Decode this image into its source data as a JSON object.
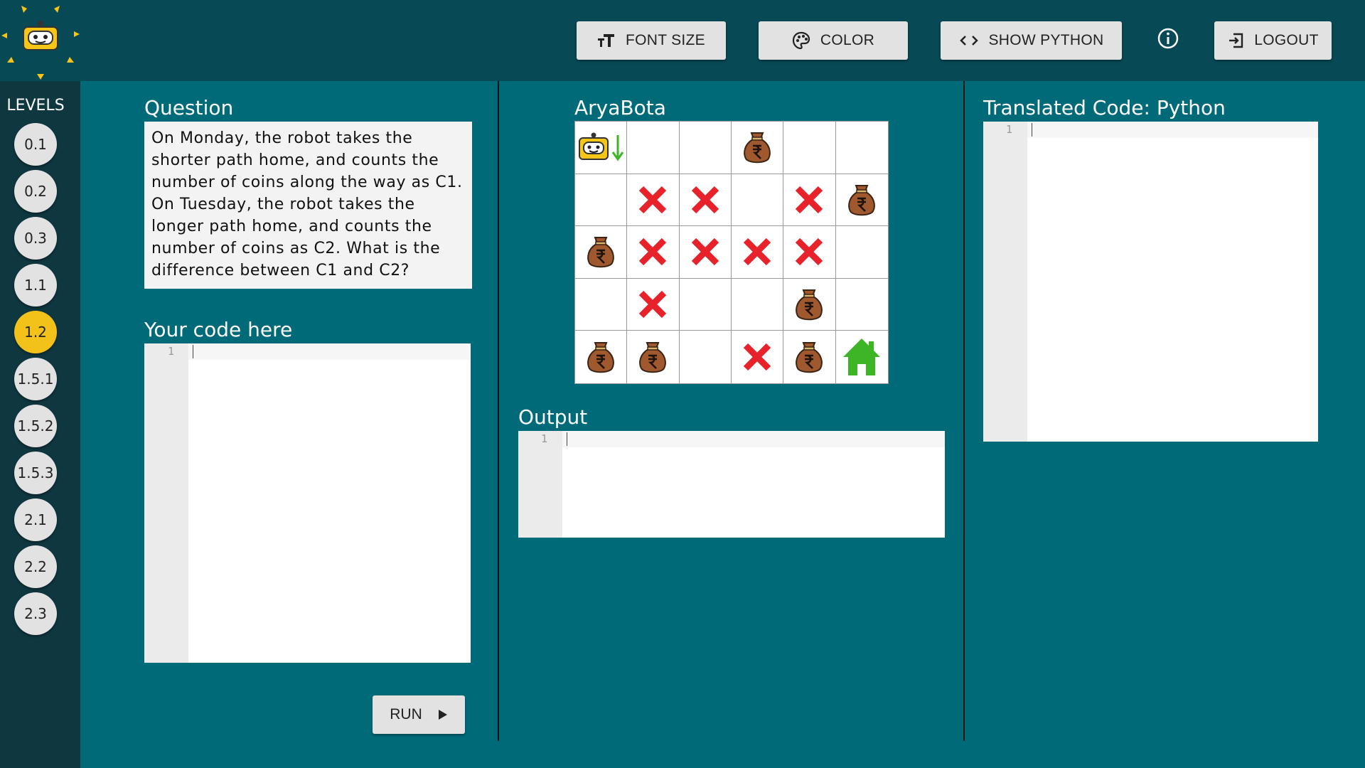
{
  "toolbar": {
    "font_size_label": "FONT SIZE",
    "color_label": "COLOR",
    "show_python_label": "SHOW PYTHON",
    "logout_label": "LOGOUT"
  },
  "sidebar": {
    "title": "LEVELS",
    "levels": [
      "0.1",
      "0.2",
      "0.3",
      "1.1",
      "1.2",
      "1.5.1",
      "1.5.2",
      "1.5.3",
      "2.1",
      "2.2",
      "2.3"
    ],
    "active_level": "1.2"
  },
  "question": {
    "title": "Question",
    "text": "On Monday, the robot takes the shorter path home, and counts the number of coins along the way as C1. On Tuesday, the robot takes the longer path home, and counts the number of coins as C2. What is the difference between C1 and C2?"
  },
  "code_editor": {
    "title": "Your code here",
    "line_number": "1"
  },
  "run_button": {
    "label": "RUN"
  },
  "board": {
    "title": "AryaBota",
    "rows": [
      [
        "robot",
        "",
        "",
        "coin",
        "",
        ""
      ],
      [
        "",
        "x",
        "x",
        "",
        "x",
        "coin"
      ],
      [
        "coin",
        "x",
        "x",
        "x",
        "x",
        ""
      ],
      [
        "",
        "x",
        "",
        "",
        "coin",
        ""
      ],
      [
        "coin",
        "coin",
        "",
        "x",
        "coin",
        "home"
      ]
    ]
  },
  "output": {
    "title": "Output",
    "line_number": "1"
  },
  "translated": {
    "title": "Translated Code: Python",
    "line_number": "1"
  },
  "colors": {
    "background": "#006a78",
    "topbar": "#074954",
    "sidebar": "#0f3740",
    "active_level": "#f2c21b",
    "obstacle": "#e8222b",
    "coin_bag": "#a0592f",
    "home": "#3db526"
  }
}
